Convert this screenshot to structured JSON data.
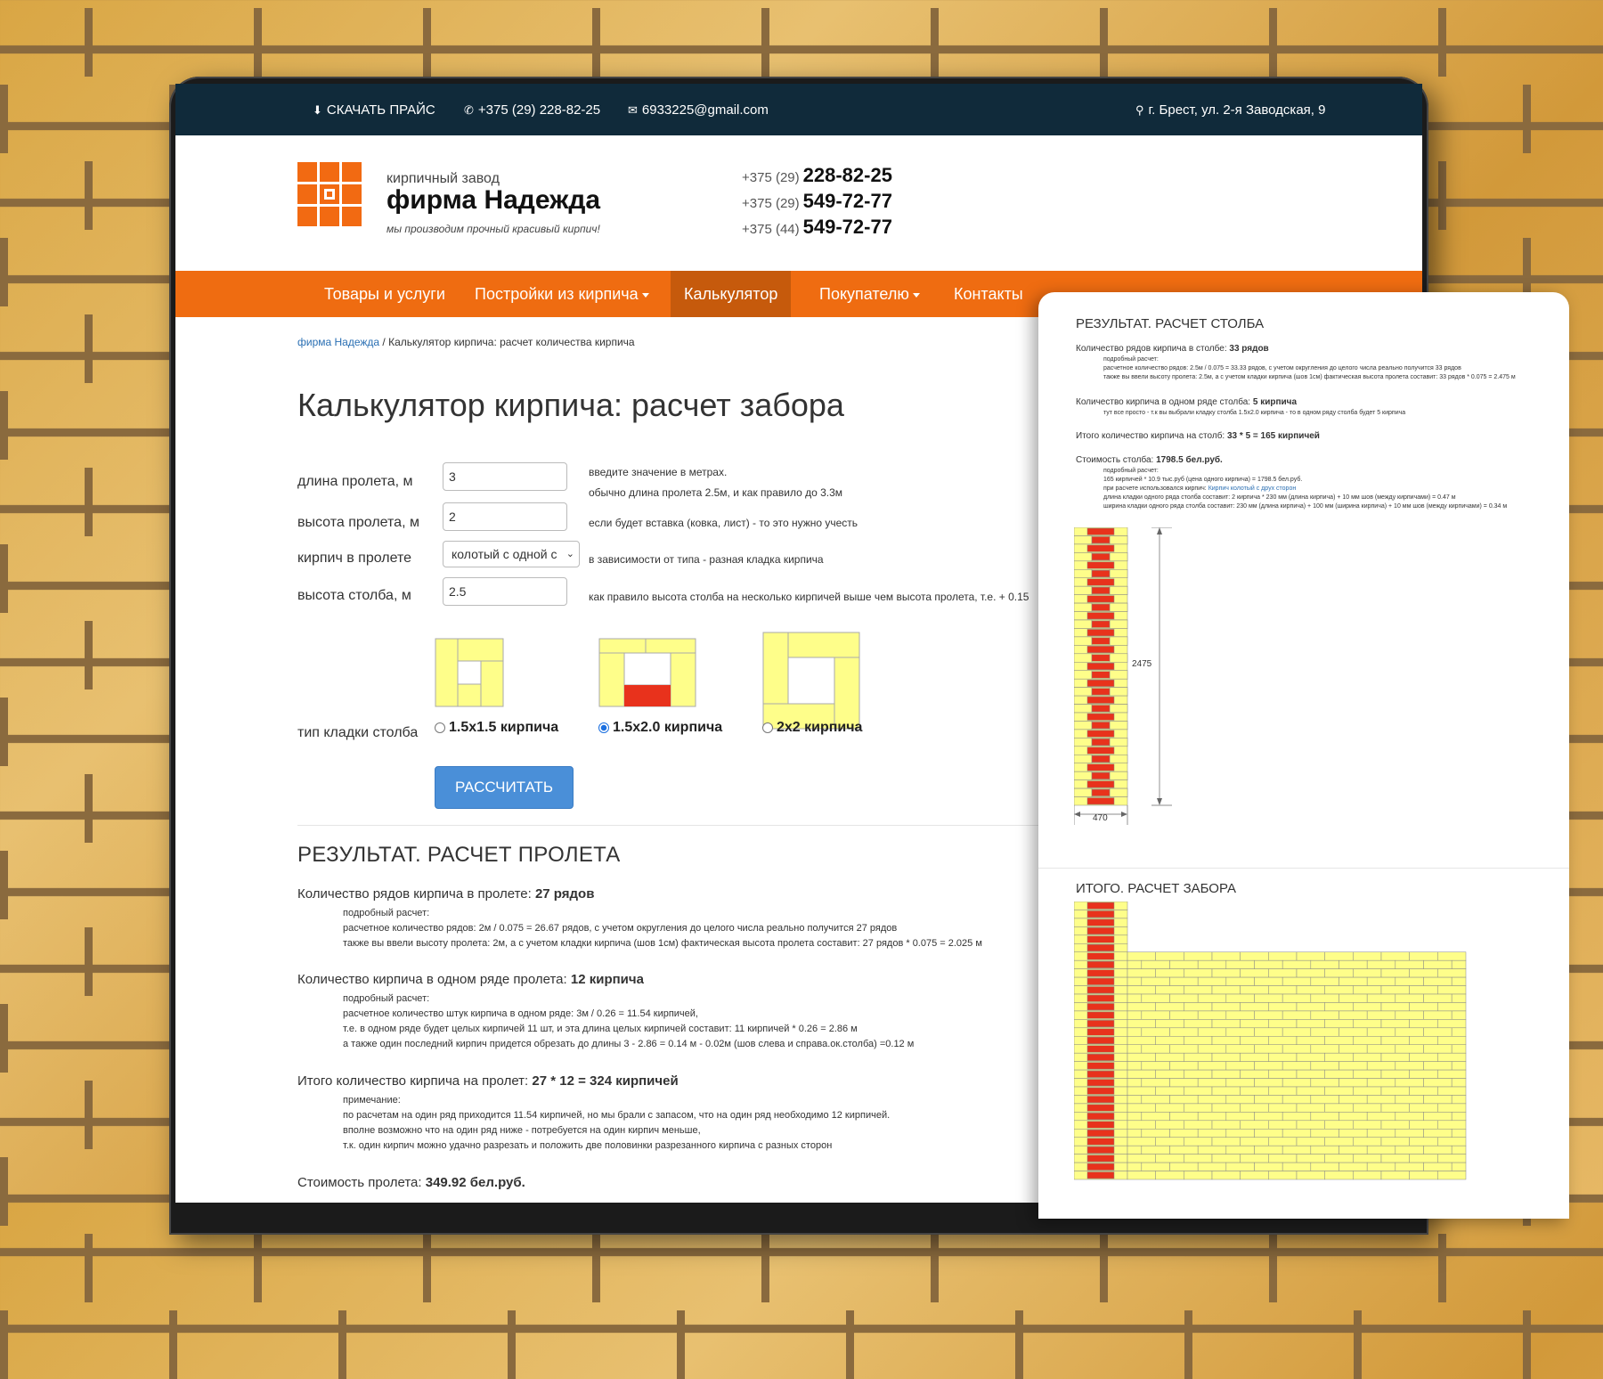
{
  "topbar": {
    "download": "СКАЧАТЬ ПРАЙС",
    "phone": "+375 (29) 228-82-25",
    "email": "6933225@gmail.com",
    "address": "г. Брест, ул. 2-я Заводская, 9"
  },
  "brand": {
    "small": "кирпичный завод",
    "name": "фирма Надежда",
    "slogan": "мы производим прочный красивый кирпич!"
  },
  "phones": [
    {
      "prefix": "+375 (29)",
      "number": "228-82-25"
    },
    {
      "prefix": "+375 (29)",
      "number": "549-72-77"
    },
    {
      "prefix": "+375 (44)",
      "number": "549-72-77"
    }
  ],
  "nav": {
    "goods": "Товары и услуги",
    "buildings": "Постройки из кирпича",
    "calculator": "Калькулятор",
    "buyer": "Покупателю",
    "contacts": "Контакты"
  },
  "breadcrumb": {
    "home": "фирма Надежда",
    "sep": " / ",
    "current": "Калькулятор кирпича: расчет количества кирпича"
  },
  "page_title": "Калькулятор кирпича: расчет забора",
  "form": {
    "span_length": {
      "label": "длина пролета, м",
      "value": "3",
      "hint1": "введите значение в метрах.",
      "hint2": "обычно длина пролета 2.5м, и как правило до 3.3м"
    },
    "span_height": {
      "label": "высота пролета, м",
      "value": "2",
      "hint": "если будет вставка (ковка, лист) - то это нужно учесть"
    },
    "brick_type": {
      "label": "кирпич в пролете",
      "value": "колотый с одной с",
      "hint": "в зависимости от типа - разная кладка кирпича"
    },
    "pillar_height": {
      "label": "высота столба, м",
      "value": "2.5",
      "hint": "как правило высота столба на несколько кирпичей выше чем высота пролета, т.е. + 0.15"
    },
    "masonry": {
      "label": "тип кладки столба",
      "options": [
        "1.5x1.5 кирпича",
        "1.5x2.0 кирпича",
        "2x2 кирпича"
      ],
      "selected_index": 1
    },
    "submit": "РАССЧИТАТЬ"
  },
  "colors": {
    "accent": "#ef6c11",
    "topbar": "#102a3a",
    "brick_yellow": "#fefe8a",
    "brick_red": "#e8321c",
    "button": "#4a8fd8"
  },
  "result_span": {
    "title": "РЕЗУЛЬТАТ. РАСЧЕТ ПРОЛЕТА",
    "rows_label": "Количество рядов кирпича в пролете:",
    "rows_value": "27 рядов",
    "rows_detail_head": "подробный расчет:",
    "rows_detail_1": "расчетное количество рядов: 2м / 0.075 = 26.67 рядов, с учетом округления до целого числа реально получится 27 рядов",
    "rows_detail_2": "также вы ввели высоту пролета: 2м, а с учетом кладки кирпича (шов 1см) фактическая высота пролета составит: 27 рядов * 0.075 = 2.025 м",
    "per_row_label": "Количество кирпича в одном ряде пролета:",
    "per_row_value": "12 кирпича",
    "per_row_head": "подробный расчет:",
    "per_row_1": "расчетное количество штук кирпича в одном ряде: 3м / 0.26 = 11.54 кирпичей,",
    "per_row_2": "т.е. в одном ряде будет целых кирпичей 11 шт, и эта длина целых кирпичей составит: 11 кирпичей * 0.26 = 2.86 м",
    "per_row_3": "а также один последний кирпич придется обрезать до длины 3 - 2.86 = 0.14 м - 0.02м (шов слева и справа.ок.столба) =0.12 м",
    "total_label": "Итого количество кирпича на пролет:",
    "total_value": "27 * 12 = 324 кирпичей",
    "note_head": "примечание:",
    "note_1": "по расчетам на один ряд приходится 11.54 кирпичей, но мы брали с запасом, что на один ряд необходимо 12 кирпичей.",
    "note_2": "вполне возможно что на один ряд ниже - потребуется на один кирпич меньше,",
    "note_3": "т.к. один кирпич можно удачно разрезать и положить две половинки разрезанного кирпича с разных сторон",
    "cost_label": "Стоимость пролета:",
    "cost_value": "349.92 бел.руб."
  },
  "result_pillar": {
    "title": "РЕЗУЛЬТАТ. РАСЧЕТ СТОЛБА",
    "rows_label": "Количество рядов кирпича в столбе:",
    "rows_value": "33 рядов",
    "rows_head": "подробный расчет:",
    "rows_1": "расчетное количество рядов: 2.5м / 0.075 = 33.33 рядов, с учетом округления до целого числа реально получится 33 рядов",
    "rows_2": "также вы ввели высоту пролета: 2.5м, а с учетом кладки кирпича (шов 1см) фактическая высота пролета составит: 33 рядов * 0.075 = 2.475 м",
    "per_row_label": "Количество кирпича в одном ряде столба:",
    "per_row_value": "5 кирпича",
    "per_row_1": "тут все просто - т.к вы выбрали кладку столба 1.5x2.0 кирпича - то в одном ряду столба будет 5 кирпича",
    "total_label": "Итого количество кирпича на столб:",
    "total_value": "33 * 5 = 165 кирпичей",
    "cost_label": "Стоимость столба:",
    "cost_value": "1798.5 бел.руб.",
    "cost_head": "подробный расчет:",
    "cost_1": "165 кирпичей * 10.9 тыс.руб (цена одного кирпича) = 1798.5 бел.руб.",
    "cost_2_pre": "при расчете использовался кирпич:",
    "cost_2_link": "Кирпич колотый с друх сторон",
    "cost_3": "длина кладки одного ряда столба составит: 2 кирпича * 230 мм (длина кирпича) + 10 мм шов (между кирпичами) = 0.47 м",
    "cost_4": "ширина кладки одного ряда столба составит: 230 мм (длина кирпича) + 100 мм (ширина кирпича) + 10 мм шов (между кирпичами) = 0.34 м",
    "dim_height": "2475",
    "dim_width": "470"
  },
  "result_fence": {
    "title": "ИТОГО. РАСЧЕТ ЗАБОРА"
  }
}
